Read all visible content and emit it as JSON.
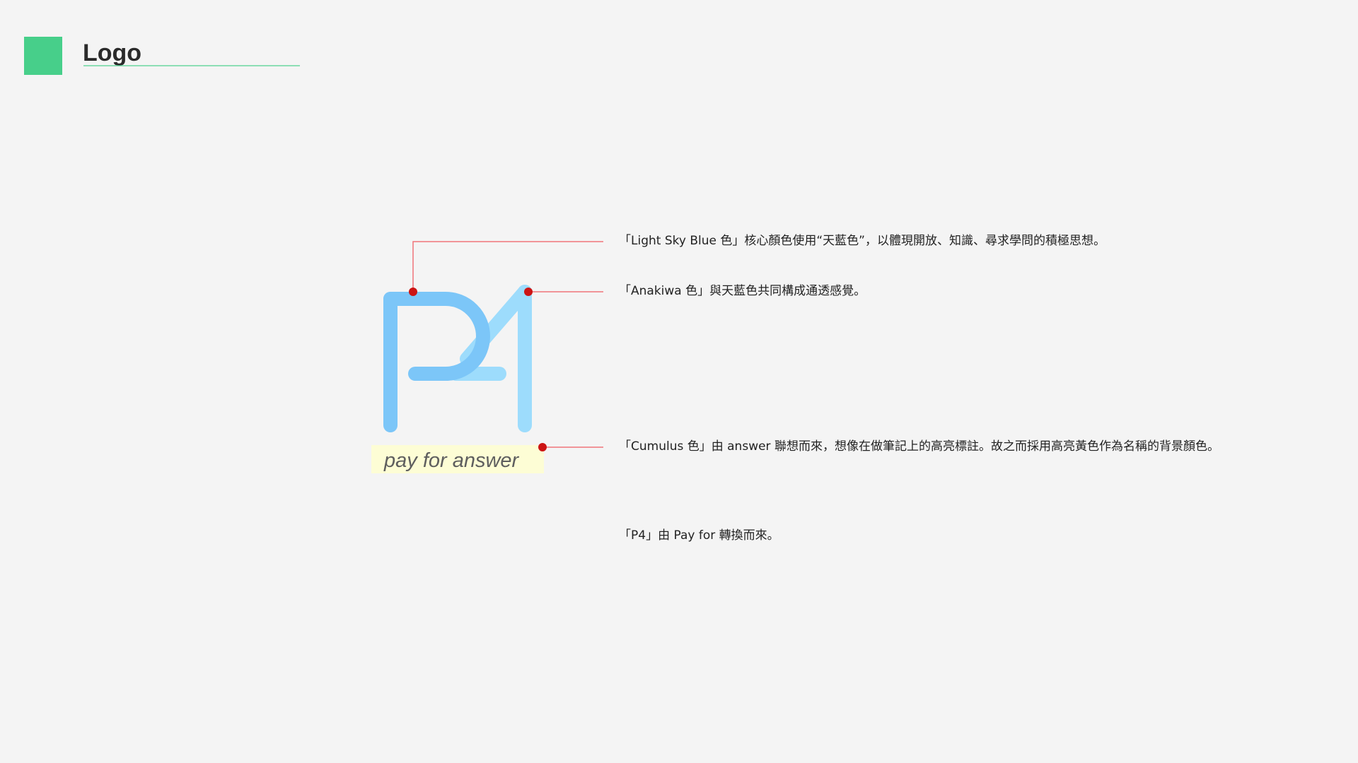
{
  "header": {
    "title": "Logo"
  },
  "logo": {
    "mark_text": "P4",
    "tagline": "pay for answer"
  },
  "annotations": [
    "「Light Sky Blue 色」核心顏色使用“天藍色”，以體現開放、知識、尋求學問的積極思想。",
    "「Anakiwa 色」與天藍色共同構成通透感覺。",
    "「Cumulus 色」由 answer 聯想而來，想像在做筆記上的高亮標註。故之而採用高亮黃色作為名稱的背景顏色。",
    "「P4」由 Pay for 轉換而來。"
  ],
  "colors": {
    "accent_green": "#47cf8a",
    "light_sky_blue": "#7cc6f8",
    "anakiwa": "#9ddcfc",
    "cumulus": "#fdfdd5",
    "leader_line": "#f0747a",
    "leader_dot": "#cc1414",
    "tagline_text": "#5e5e5e"
  }
}
